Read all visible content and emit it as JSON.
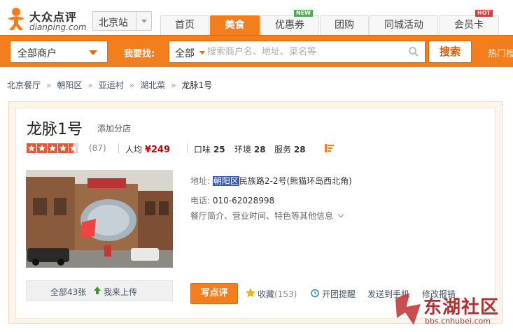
{
  "logo": {
    "cn": "大众点评",
    "en": "dianping.com"
  },
  "city": {
    "label": "北京站"
  },
  "nav": {
    "tabs": [
      {
        "label": "首页"
      },
      {
        "label": "美食"
      },
      {
        "label": "优惠券",
        "badge": "NEW"
      },
      {
        "label": "团购"
      },
      {
        "label": "同城活动"
      },
      {
        "label": "会员卡",
        "badge": "HOT"
      }
    ],
    "active_index": 1
  },
  "searchbar": {
    "category": "全部商户",
    "prompt": "我要找:",
    "scope": "全部",
    "placeholder": "搜索商户名、地址、菜名等",
    "button": "搜索",
    "hot": "热门搜"
  },
  "breadcrumb": [
    "北京餐厅",
    "朝阳区",
    "亚运村",
    "湖北菜",
    "龙脉1号"
  ],
  "shop": {
    "name": "龙脉1号",
    "branch_link": "添加分店",
    "rating_stars": 4.5,
    "review_count": "(87)",
    "avg_label": "人均",
    "avg_price": "¥249",
    "taste_label": "口味",
    "taste": "25",
    "env_label": "环境",
    "env": "28",
    "service_label": "服务",
    "service": "28",
    "address_label": "地址:",
    "address_highlight": "朝阳区",
    "address_rest": "民族路2-2号(熊猫环岛西北角)",
    "phone_label": "电话:",
    "phone": "010-62028998",
    "more_info": "餐厅简介、营业时间、特色等其他信息",
    "photo_count": "全部43张",
    "upload": "我来上传"
  },
  "actions": {
    "write_review": "写点评",
    "favorite": "收藏",
    "favorite_count": "(153)",
    "group_alert": "开团提醒",
    "send_phone": "发送到手机",
    "fix_info": "修改报错"
  },
  "watermark": {
    "text": "东湖社区",
    "url": "bbs.cnhubei.com"
  },
  "colors": {
    "brand": "#f37e1e",
    "price": "#cc0000",
    "link": "#445566"
  }
}
